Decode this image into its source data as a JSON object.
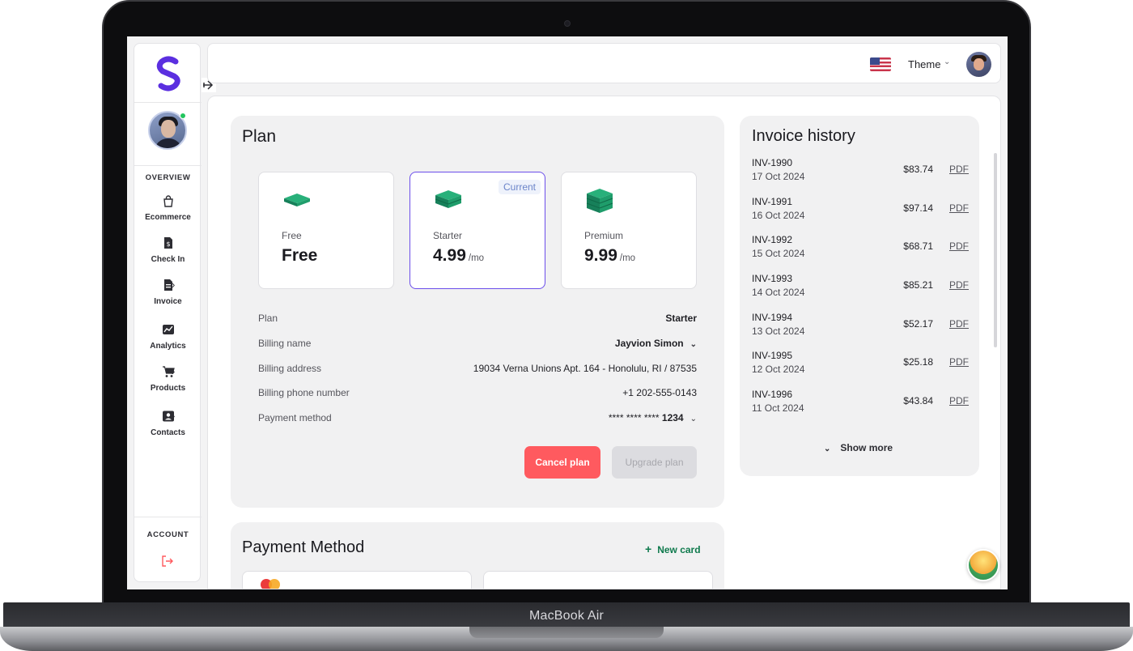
{
  "device": {
    "label": "MacBook Air"
  },
  "sidebar": {
    "overview_label": "OVERVIEW",
    "account_label": "ACCOUNT",
    "items": [
      {
        "label": "Ecommerce",
        "icon": "shopping-bag-icon",
        "has_chevron": false
      },
      {
        "label": "Check In",
        "icon": "receipt-dollar-icon",
        "has_chevron": false
      },
      {
        "label": "Invoice",
        "icon": "document-icon",
        "has_chevron": true
      },
      {
        "label": "Analytics",
        "icon": "chart-line-icon",
        "has_chevron": false
      },
      {
        "label": "Products",
        "icon": "cart-icon",
        "has_chevron": true
      },
      {
        "label": "Contacts",
        "icon": "contact-card-icon",
        "has_chevron": true
      }
    ],
    "chevron": "›"
  },
  "topbar": {
    "theme_label": "Theme",
    "theme_chevron": "⌄"
  },
  "plan": {
    "title": "Plan",
    "tiers": [
      {
        "name": "Free",
        "price": "Free",
        "unit": ""
      },
      {
        "name": "Starter",
        "price": "4.99",
        "unit": "/mo",
        "badge": "Current"
      },
      {
        "name": "Premium",
        "price": "9.99",
        "unit": "/mo"
      }
    ],
    "details": [
      {
        "label": "Plan",
        "value": "Starter"
      },
      {
        "label": "Billing name",
        "value": "Jayvion Simon"
      },
      {
        "label": "Billing address",
        "value": "19034 Verna Unions Apt. 164 - Honolulu, RI / 87535"
      },
      {
        "label": "Billing phone number",
        "value": "+1 202-555-0143"
      },
      {
        "label": "Payment method",
        "value_masked": "**** **** ****",
        "value_last": "1234"
      }
    ],
    "cancel_label": "Cancel plan",
    "upgrade_label": "Upgrade plan"
  },
  "payment": {
    "title": "Payment Method",
    "new_card_label": "New card",
    "plus": "+"
  },
  "invoices": {
    "title": "Invoice history",
    "rows": [
      {
        "id": "INV-1990",
        "date": "17 Oct 2024",
        "amount": "$83.74",
        "link": "PDF"
      },
      {
        "id": "INV-1991",
        "date": "16 Oct 2024",
        "amount": "$97.14",
        "link": "PDF"
      },
      {
        "id": "INV-1992",
        "date": "15 Oct 2024",
        "amount": "$68.71",
        "link": "PDF"
      },
      {
        "id": "INV-1993",
        "date": "14 Oct 2024",
        "amount": "$85.21",
        "link": "PDF"
      },
      {
        "id": "INV-1994",
        "date": "13 Oct 2024",
        "amount": "$52.17",
        "link": "PDF"
      },
      {
        "id": "INV-1995",
        "date": "12 Oct 2024",
        "amount": "$25.18",
        "link": "PDF"
      },
      {
        "id": "INV-1996",
        "date": "11 Oct 2024",
        "amount": "$43.84",
        "link": "PDF"
      }
    ],
    "show_more_label": "Show more",
    "show_more_chevron": "⌄"
  },
  "colors": {
    "accent": "#6b4eea",
    "danger": "#ff5a5f",
    "brand": "#5b2fe0",
    "success": "#0f7a4d",
    "tier_icon": "#1f9d6b"
  }
}
